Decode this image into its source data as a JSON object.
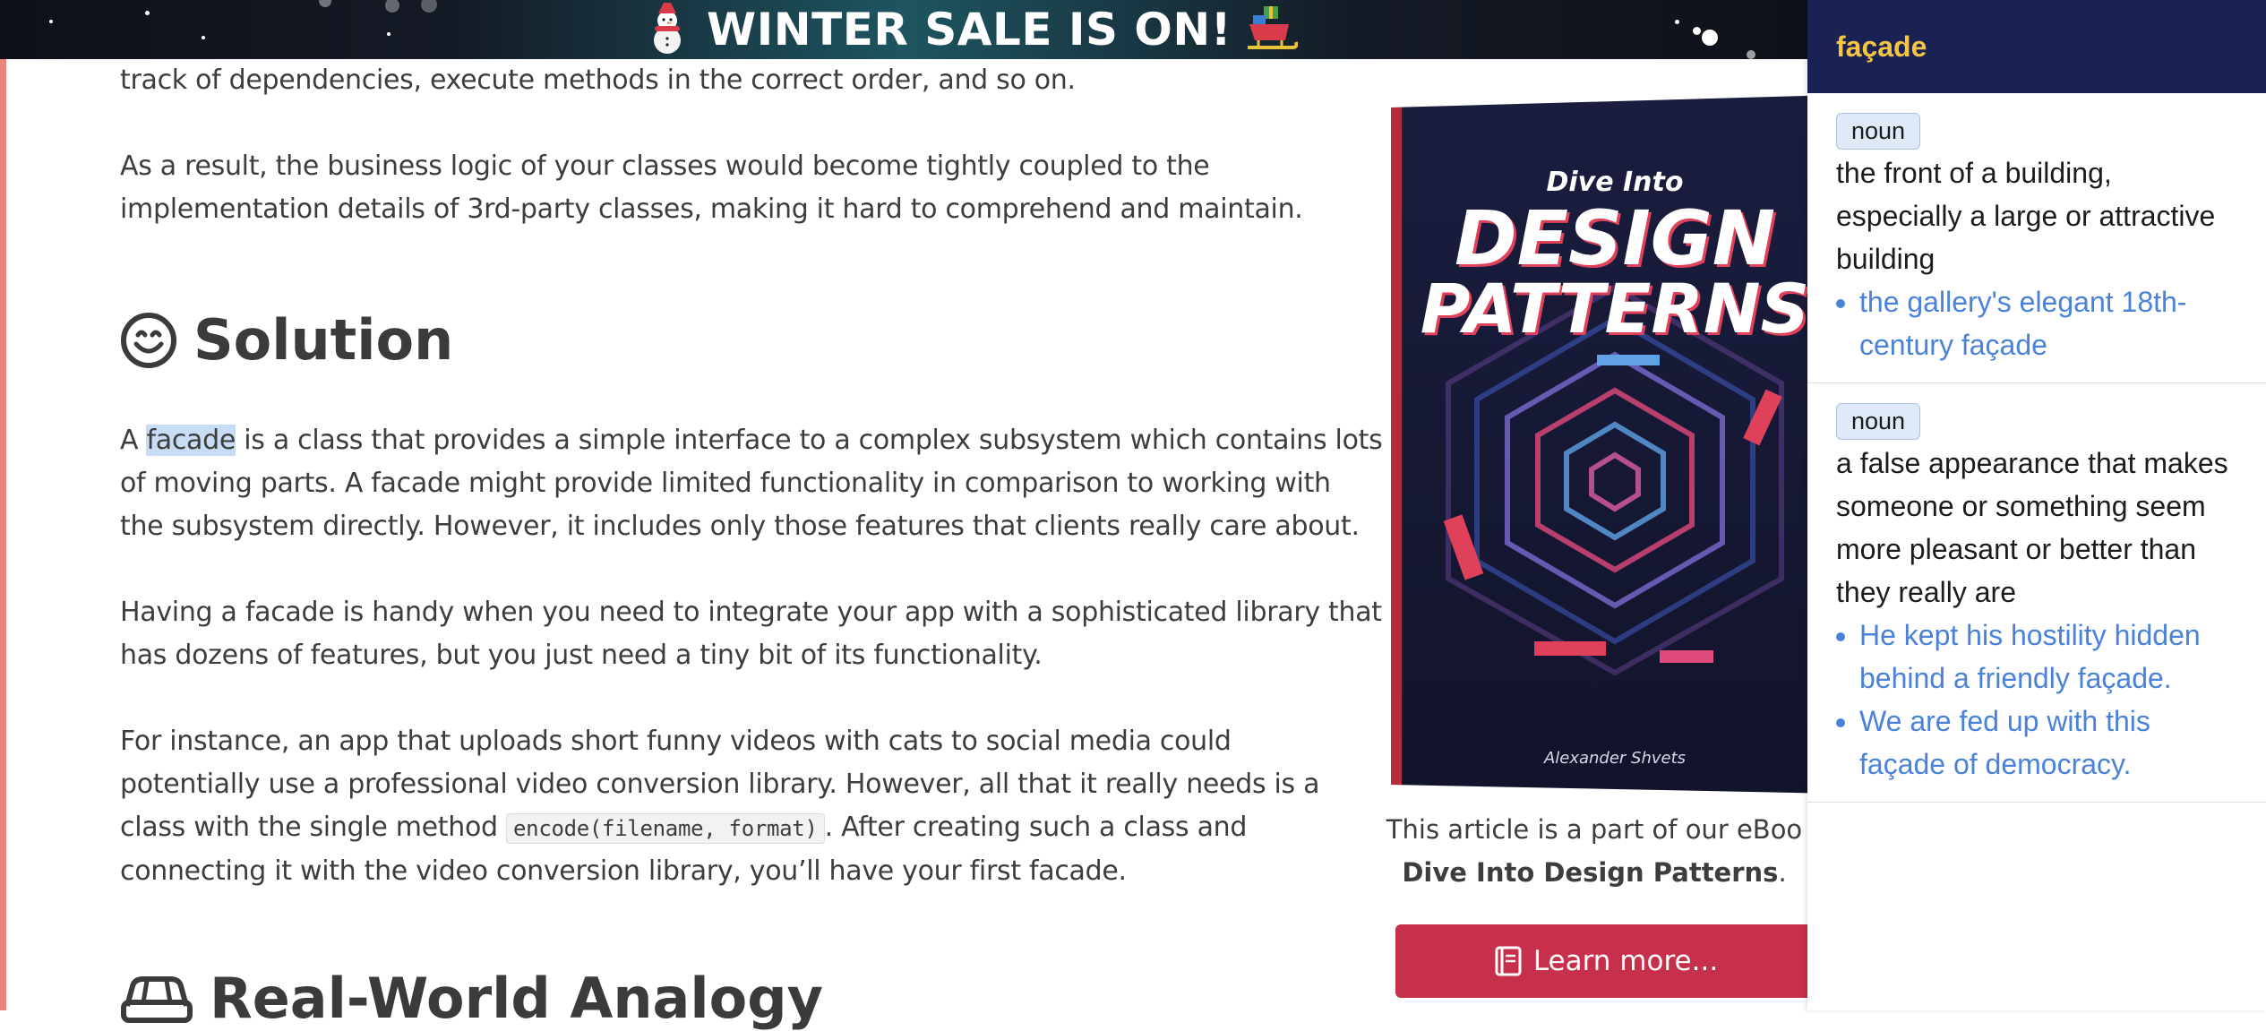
{
  "promo": {
    "text": "WINTER SALE IS ON!"
  },
  "article": {
    "p_top": "track of dependencies, execute methods in the correct order, and so on.",
    "p_result": [
      "As a result, the business logic of your classes would become tightly coupled to the",
      "implementation details of 3rd-party classes, making it hard to comprehend and maintain."
    ],
    "solution_heading": "Solution",
    "p_solution": {
      "lead": "A ",
      "highlight": "facade",
      "rest_line1": " is a class that provides a simple interface to a complex subsystem which contains lots",
      "line2": "of moving parts. A facade might provide limited functionality in comparison to working with",
      "line3": "the subsystem directly. However, it includes only those features that clients really care about."
    },
    "p_handy": [
      "Having a facade is handy when you need to integrate your app with a sophisticated library that",
      "has dozens of features, but you just need a tiny bit of its functionality."
    ],
    "p_instance": {
      "line1": "For instance, an app that uploads short funny videos with cats to social media could",
      "line2": "potentially use a professional video conversion library. However, all that it really needs is a",
      "line3_before": "class with the single method ",
      "code": "encode(filename, format)",
      "line3_after": ". After creating such a class and",
      "line4": "connecting it with the video conversion library, you’ll have your first facade."
    },
    "analogy_heading": "Real-World Analogy"
  },
  "book": {
    "cover_title_small": "Dive Into",
    "cover_title_line1": "DESIGN",
    "cover_title_line2": "PATTERNS",
    "cover_author": "Alexander Shvets",
    "caption_line1": "This article is a part of our eBoo",
    "caption_bold": "Dive Into Design Patterns",
    "caption_period": ".",
    "button_label": "Learn more..."
  },
  "dictionary": {
    "word": "façade",
    "senses": [
      {
        "pos": "noun",
        "definition": "the front of a building, especially a large or attractive building",
        "examples": [
          "the gallery's elegant 18th-century façade"
        ]
      },
      {
        "pos": "noun",
        "definition": "a false appearance that makes someone or something seem more pleasant or better than they really are",
        "examples": [
          "He kept his hostility hidden behind a friendly façade.",
          "We are fed up with this façade of democracy."
        ]
      }
    ]
  },
  "colors": {
    "dict_header_bg": "#1a2253",
    "dict_word": "#f5c542",
    "example_text": "#4a82d9",
    "button_bg": "#c6304a",
    "accent_stripe": "#e8857d"
  },
  "icons": [
    "snowman-icon",
    "sleigh-icon",
    "smiley-icon",
    "car-icon",
    "book-icon"
  ]
}
